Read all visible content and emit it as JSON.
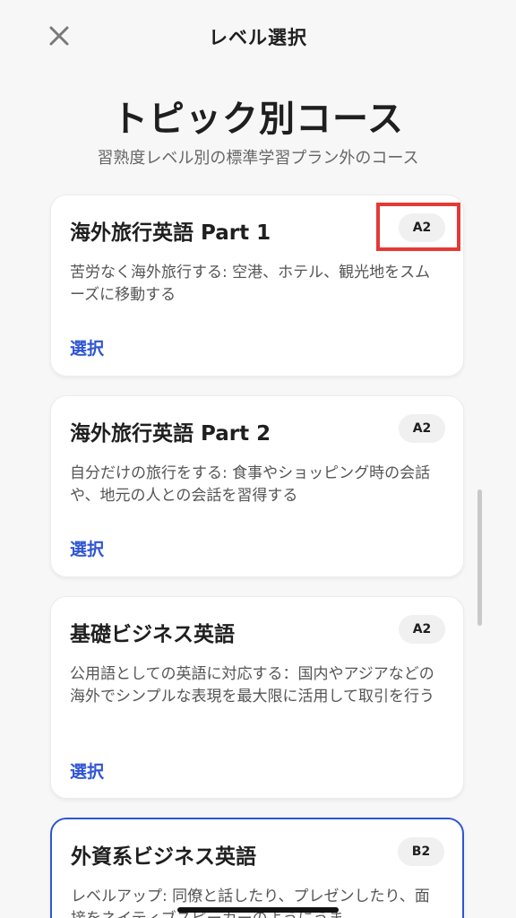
{
  "header": {
    "title": "レベル選択",
    "close_icon": "close-icon"
  },
  "hero": {
    "title": "トピック別コース",
    "subtitle": "習熟度レベル別の標準学習プラン外のコース"
  },
  "courses": [
    {
      "title": "海外旅行英語 Part 1",
      "level": "A2",
      "description": "苦労なく海外旅行する: 空港、ホテル、観光地をスムーズに移動する",
      "select_label": "選択",
      "highlighted": true
    },
    {
      "title": "海外旅行英語 Part 2",
      "level": "A2",
      "description": "自分だけの旅行をする: 食事やショッピング時の会話や、地元の人との会話を習得する",
      "select_label": "選択"
    },
    {
      "title": "基礎ビジネス英語",
      "level": "A2",
      "description": "公用語としての英語に対応する：国内やアジアなどの海外でシンプルな表現を最大限に活用して取引を行う",
      "select_label": "選択"
    },
    {
      "title": "外資系ビジネス英語",
      "level": "B2",
      "description": "レベルアップ: 同僚と話したり、プレゼンしたり、面接をネイティブスピーカーのようにうま",
      "selected": true
    }
  ],
  "colors": {
    "accent": "#2f55d4",
    "highlight": "#e53935",
    "badge_bg": "#f0f0f0"
  }
}
